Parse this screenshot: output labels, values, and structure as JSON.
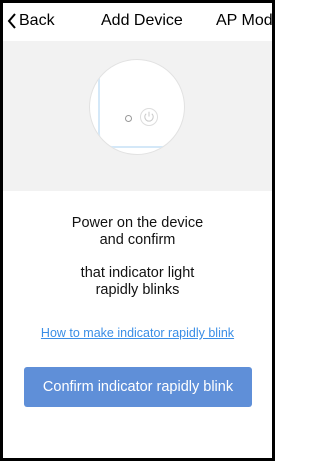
{
  "nav": {
    "back_label": "Back",
    "title": "Add Device",
    "mode_label": "AP Mode"
  },
  "hero": {
    "device_icon": "power-icon"
  },
  "instructions": {
    "line1": "Power on the device",
    "line2": "and confirm",
    "line3": "that indicator light",
    "line4": "rapidly blinks"
  },
  "help_link_label": "How to make indicator rapidly blink",
  "confirm_button_label": "Confirm indicator rapidly blink",
  "colors": {
    "primary_button": "#5f8fd8",
    "link": "#3a8ee6",
    "hero_background": "#f2f2f2"
  }
}
